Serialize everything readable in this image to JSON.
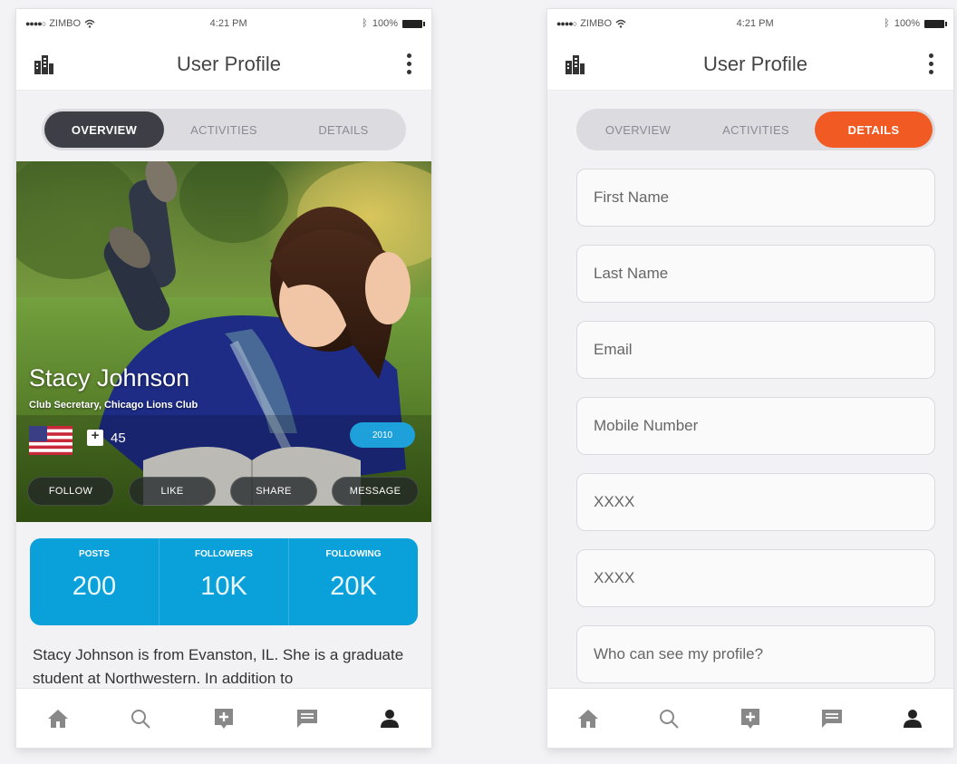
{
  "left": {
    "status": {
      "carrier": "ZIMBO",
      "time": "4:21 PM",
      "battery": "100%"
    },
    "header": {
      "title": "User Profile",
      "logo_icon": "building-icon",
      "menu_icon": "more-vertical-icon"
    },
    "tabs": [
      {
        "label": "OVERVIEW",
        "active": true
      },
      {
        "label": "ACTIVITIES",
        "active": false
      },
      {
        "label": "DETAILS",
        "active": false
      }
    ],
    "profile": {
      "name": "Stacy Johnson",
      "subtitle": "Club Secretary, Chicago Lions Club",
      "likes": "45",
      "badge": "2010"
    },
    "actions": [
      "FOLLOW",
      "LIKE",
      "SHARE",
      "MESSAGE"
    ],
    "stats": [
      {
        "label": "POSTS",
        "value": "200"
      },
      {
        "label": "FOLLOWERS",
        "value": "10K"
      },
      {
        "label": "FOLLOWING",
        "value": "20K"
      }
    ],
    "bio": "Stacy Johnson is from Evanston, IL. She is a graduate student at Northwestern. In addition to"
  },
  "right": {
    "status": {
      "carrier": "ZIMBO",
      "time": "4:21 PM",
      "battery": "100%"
    },
    "header": {
      "title": "User Profile"
    },
    "tabs": [
      {
        "label": "OVERVIEW",
        "active": false
      },
      {
        "label": "ACTIVITIES",
        "active": false
      },
      {
        "label": "DETAILS",
        "active": true
      }
    ],
    "fields": [
      {
        "placeholder": "First Name"
      },
      {
        "placeholder": "Last Name"
      },
      {
        "placeholder": "Email"
      },
      {
        "placeholder": "Mobile Number"
      },
      {
        "placeholder": "XXXX"
      },
      {
        "placeholder": "XXXX"
      },
      {
        "placeholder": "Who can see my profile?"
      }
    ]
  },
  "bottom_nav": [
    "home-icon",
    "search-icon",
    "add-post-icon",
    "chat-icon",
    "profile-icon"
  ],
  "colors": {
    "accent_blue": "#0aa0d9",
    "accent_orange": "#f15a22",
    "tab_dark": "#3e3f46"
  }
}
